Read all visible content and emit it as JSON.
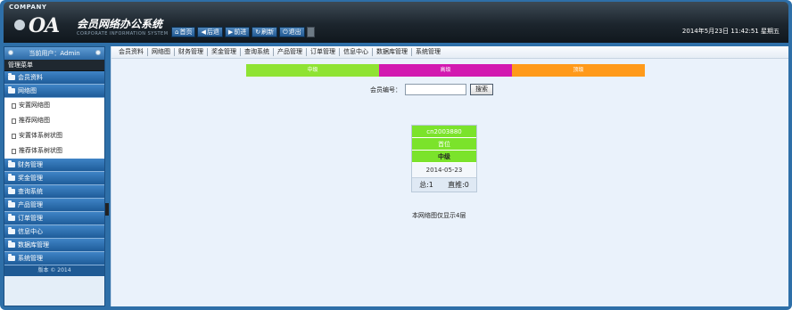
{
  "header": {
    "company": "COMPANY",
    "logo": "OA",
    "title": "会员网络办公系统",
    "subtitle": "CORPORATE INFORMATION SYSTEM",
    "datetime": "2014年5月23日 11:42:51 星期五",
    "buttons": [
      {
        "label": "首页",
        "icon": "home-icon"
      },
      {
        "label": "后退",
        "icon": "arrow-left-icon"
      },
      {
        "label": "前进",
        "icon": "arrow-right-icon"
      },
      {
        "label": "刷新",
        "icon": "refresh-icon"
      },
      {
        "label": "退出",
        "icon": "power-icon"
      }
    ]
  },
  "sidebar": {
    "user_label": "当前用户：Admin",
    "menu_header": "管理菜单",
    "items": [
      {
        "label": "会员资料"
      },
      {
        "label": "网络图"
      },
      {
        "label": "财务管理"
      },
      {
        "label": "奖金管理"
      },
      {
        "label": "查询系统"
      },
      {
        "label": "产品管理"
      },
      {
        "label": "订单管理"
      },
      {
        "label": "信息中心"
      },
      {
        "label": "数据库管理"
      },
      {
        "label": "系统管理"
      }
    ],
    "subitems": [
      {
        "label": "安置网络图"
      },
      {
        "label": "推荐网络图"
      },
      {
        "label": "安置体系树状图"
      },
      {
        "label": "推荐体系树状图"
      }
    ],
    "copyright": "版本 © 2014"
  },
  "navbar": {
    "items": [
      "会员资料",
      "网络图",
      "财务管理",
      "奖金管理",
      "查询系统",
      "产品管理",
      "订单管理",
      "信息中心",
      "数据库管理",
      "系统管理"
    ]
  },
  "legend": [
    {
      "label": "中级",
      "color": "#8fe333"
    },
    {
      "label": "高级",
      "color": "#d219b0"
    },
    {
      "label": "顶级",
      "color": "#ff9a1a"
    }
  ],
  "search": {
    "label": "会员编号：",
    "value": "",
    "button": "搜索"
  },
  "node": {
    "id": "cn2003880",
    "name": "首位",
    "level": "中级",
    "date": "2014-05-23",
    "total": "总:1",
    "direct": "直推:0"
  },
  "caption": "本网络图仅显示4层"
}
